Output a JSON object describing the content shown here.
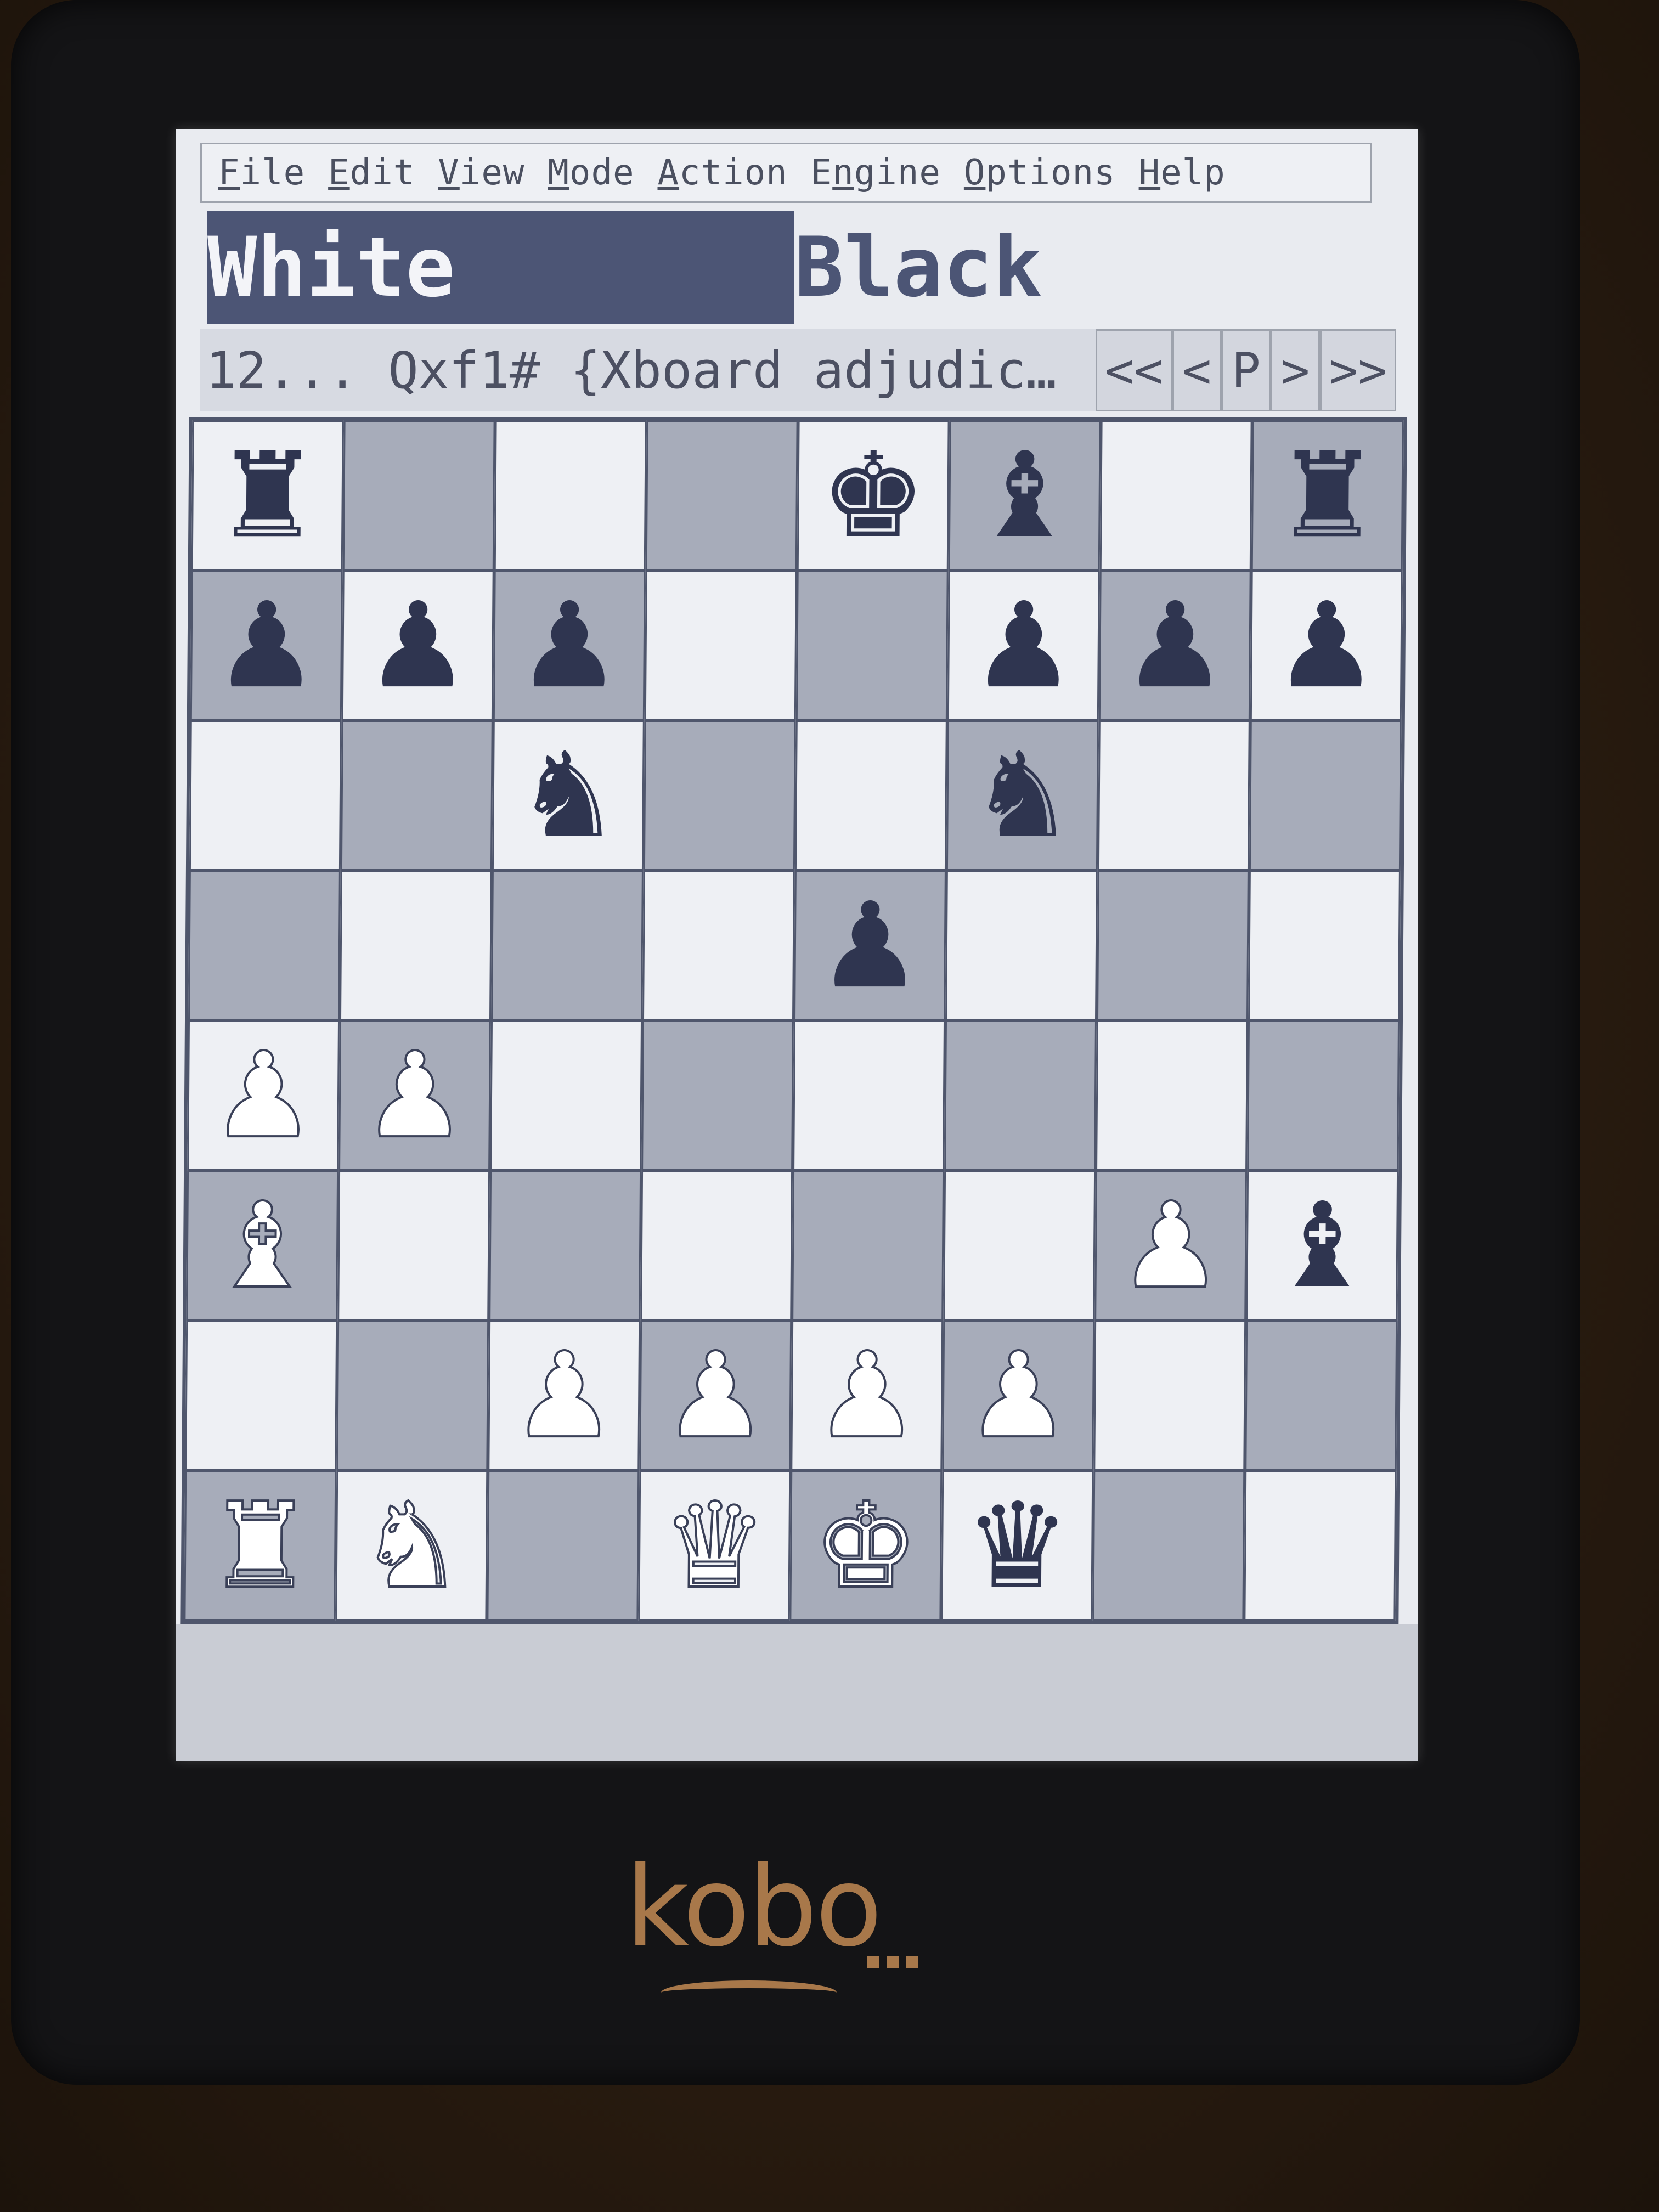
{
  "menu": [
    {
      "key": "F",
      "rest": "ile"
    },
    {
      "key": "E",
      "rest": "dit"
    },
    {
      "key": "V",
      "rest": "iew"
    },
    {
      "key": "M",
      "rest": "ode"
    },
    {
      "key": "A",
      "rest": "ction"
    },
    {
      "pre": "E",
      "key": "n",
      "rest": "gine"
    },
    {
      "key": "O",
      "rest": "ptions"
    },
    {
      "key": "H",
      "rest": "elp"
    }
  ],
  "clocks": {
    "white": "White",
    "black": "Black"
  },
  "move_text": "12... Qxf1# {Xboard adjudic…",
  "nav": [
    "<<",
    "<",
    "P",
    ">",
    ">>"
  ],
  "device_logo": "kobo",
  "board": [
    [
      "br",
      "",
      "",
      "",
      "bk",
      "bb",
      "",
      "br"
    ],
    [
      "bp",
      "bp",
      "bp",
      "",
      "",
      "bp",
      "bp",
      "bp"
    ],
    [
      "",
      "",
      "bn",
      "",
      "",
      "bn",
      "",
      ""
    ],
    [
      "",
      "",
      "",
      "",
      "bp",
      "",
      "",
      ""
    ],
    [
      "wp",
      "wp",
      "",
      "",
      "",
      "",
      "",
      ""
    ],
    [
      "wb",
      "",
      "",
      "",
      "",
      "",
      "wp",
      "bb"
    ],
    [
      "",
      "",
      "wp",
      "wp",
      "wp",
      "wp",
      "",
      ""
    ],
    [
      "wr",
      "wn",
      "",
      "wq",
      "wk",
      "bq",
      "",
      ""
    ]
  ],
  "piece_glyphs": {
    "k": "♚",
    "q": "♛",
    "r": "♜",
    "b": "♝",
    "n": "♞",
    "p": "♟"
  },
  "colors": {
    "dark_square": "#a7acba",
    "light_square": "#eef0f4",
    "active_clock": "#4c5575",
    "logo": "#a8784a"
  }
}
